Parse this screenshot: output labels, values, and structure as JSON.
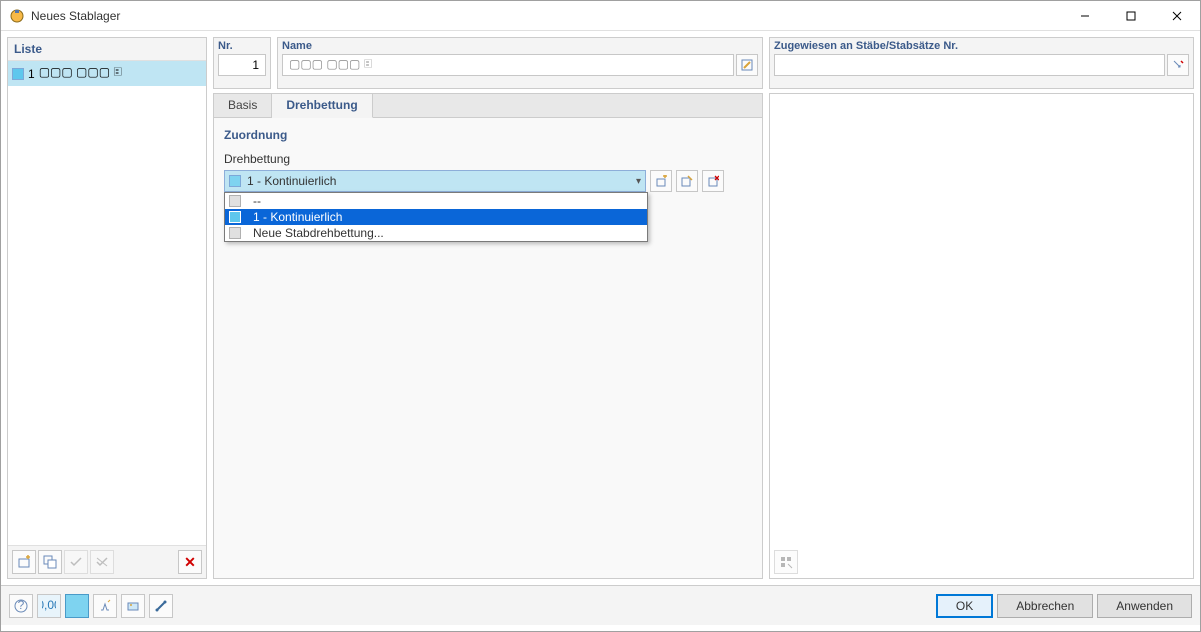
{
  "window": {
    "title": "Neues Stablager"
  },
  "left": {
    "header": "Liste",
    "items": [
      {
        "num": "1",
        "label": "▢▢▢ ▢▢▢ 🗉"
      }
    ]
  },
  "top": {
    "nr_label": "Nr.",
    "nr_value": "1",
    "name_label": "Name",
    "name_value": "▢▢▢ ▢▢▢ 🗉",
    "zug_label": "Zugewiesen an Stäbe/Stabsätze Nr.",
    "zug_value": ""
  },
  "tabs": {
    "basis": "Basis",
    "drehbettung": "Drehbettung"
  },
  "zuordnung": {
    "group": "Zuordnung",
    "field": "Drehbettung",
    "selected": "1 - Kontinuierlich",
    "options": [
      {
        "label": "--",
        "selected": false
      },
      {
        "label": "1 - Kontinuierlich",
        "selected": true
      },
      {
        "label": "Neue Stabdrehbettung...",
        "selected": false
      }
    ]
  },
  "buttons": {
    "ok": "OK",
    "cancel": "Abbrechen",
    "apply": "Anwenden"
  }
}
